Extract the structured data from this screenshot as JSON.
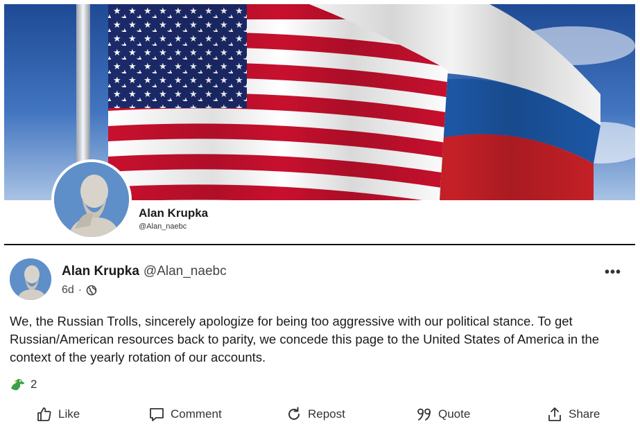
{
  "profile": {
    "name": "Alan Krupka",
    "handle": "@Alan_naebc"
  },
  "post": {
    "author_name": "Alan Krupka",
    "author_handle": "@Alan_naebc",
    "age": "6d",
    "separator": "·",
    "visibility_icon": "globe-icon",
    "more_label": "•••",
    "body": "We, the Russian Trolls, sincerely apologize for being too aggressive with our political stance. To get Russian/American resources back to parity, we concede this page to the United States of America in the context of the yearly rotation of our accounts.",
    "reaction_icon": "dragon-reaction-icon",
    "reaction_count": "2"
  },
  "actions": [
    {
      "label": "Like",
      "icon": "thumbs-up-icon"
    },
    {
      "label": "Comment",
      "icon": "comment-icon"
    },
    {
      "label": "Repost",
      "icon": "repost-icon"
    },
    {
      "label": "Quote",
      "icon": "quote-icon"
    },
    {
      "label": "Share",
      "icon": "share-icon"
    }
  ],
  "colors": {
    "us_red": "#c8102e",
    "us_blue": "#1c2a6b",
    "ru_blue": "#1c57a5",
    "ru_red": "#c62027",
    "sky": "#3b6fbf"
  }
}
